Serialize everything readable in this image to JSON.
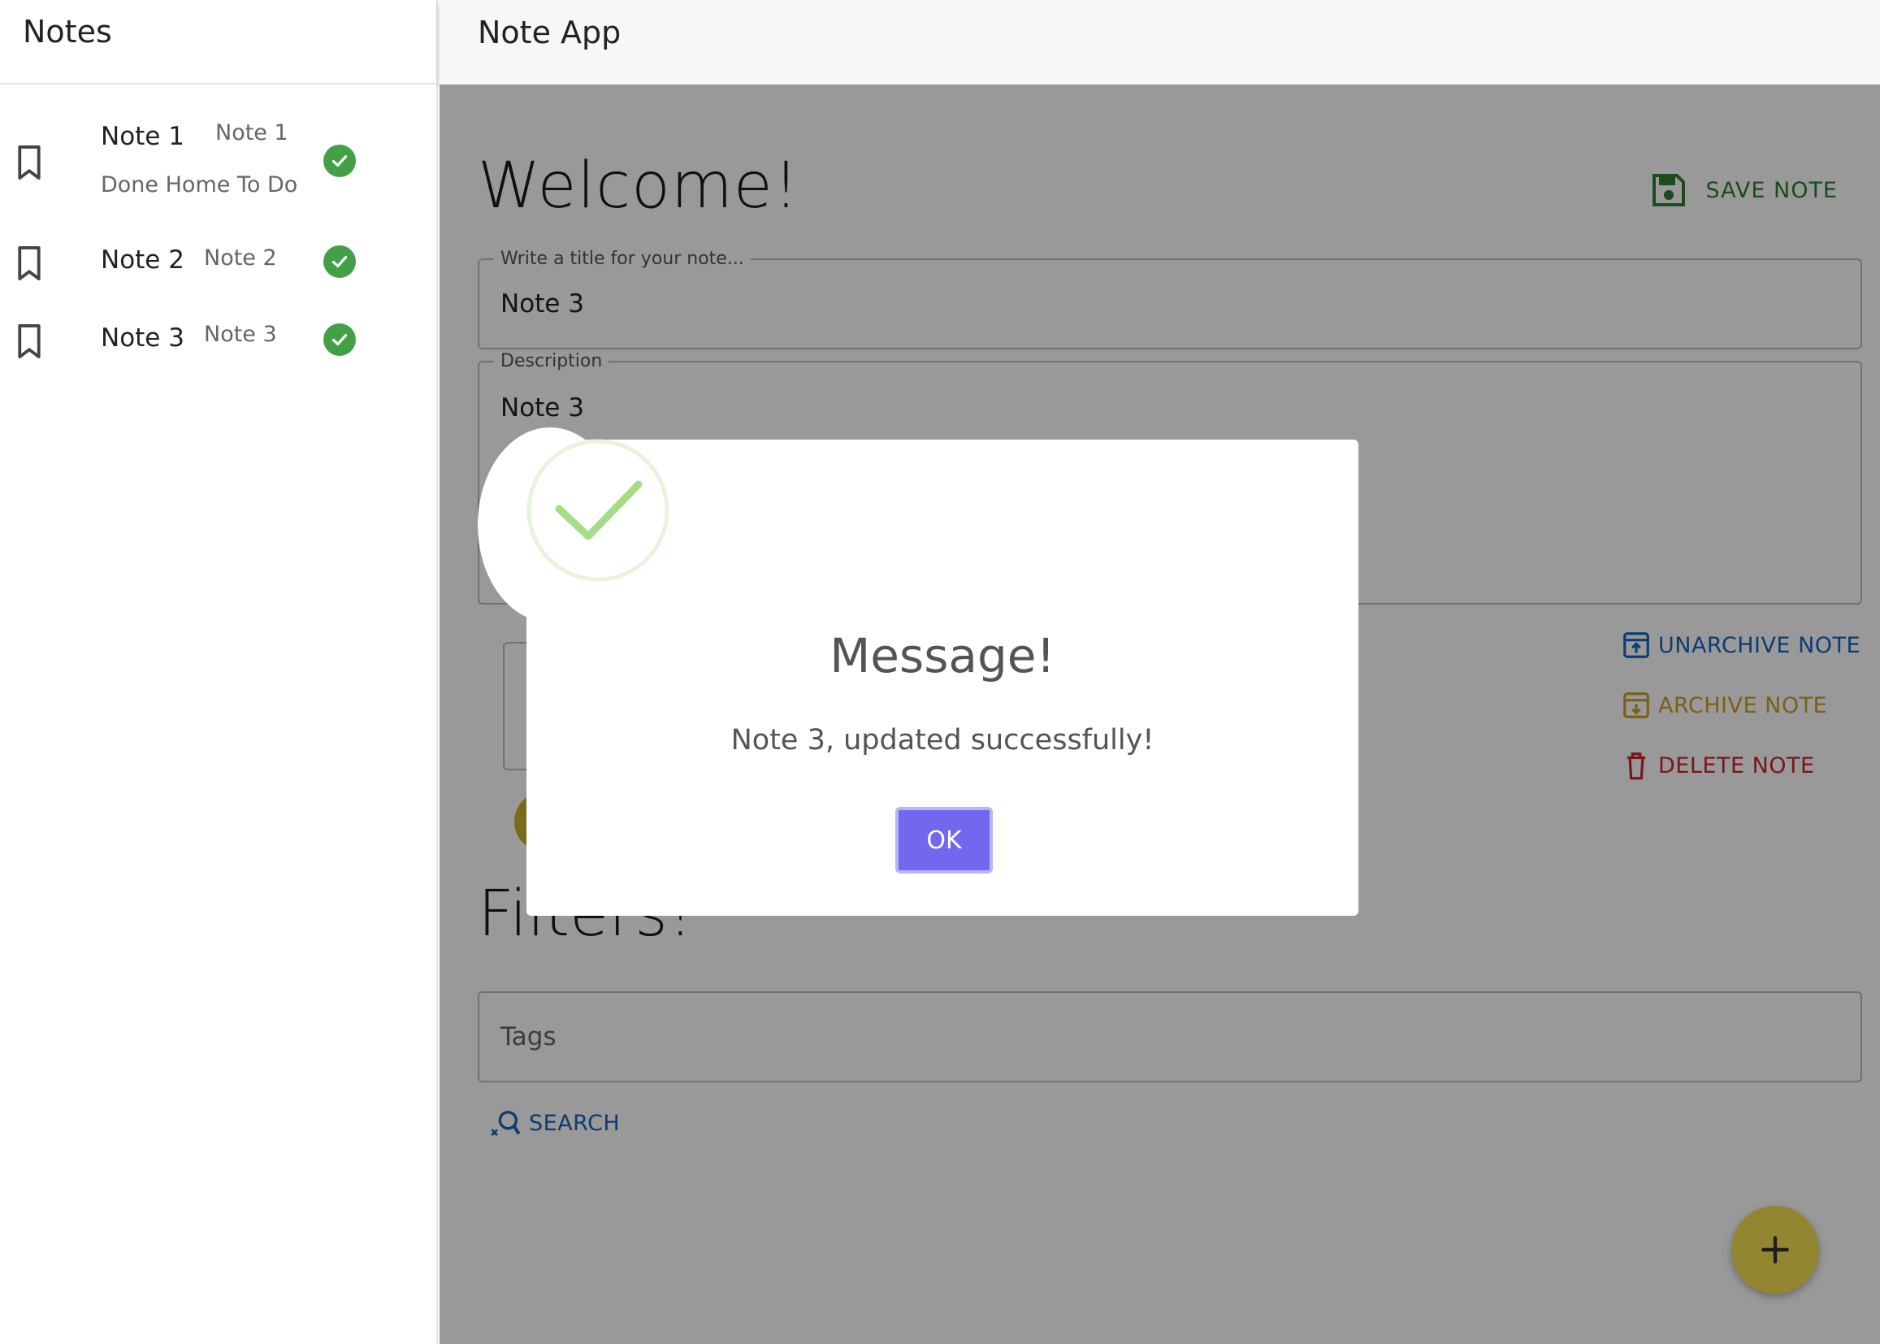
{
  "sidebar": {
    "title": "Notes",
    "notes": [
      {
        "name": "Note 1",
        "description": "Note 1",
        "tags": "Done Home To Do",
        "done": true
      },
      {
        "name": "Note 2",
        "description": "Note 2",
        "tags": "",
        "done": true
      },
      {
        "name": "Note 3",
        "description": "Note 3",
        "tags": "",
        "done": true
      }
    ]
  },
  "appbar": {
    "title": "Note App"
  },
  "editor": {
    "heading": "Welcome!",
    "save_label": "SAVE NOTE",
    "title_label": "Write a title for your note...",
    "title_value": "Note 3",
    "description_label": "Description",
    "description_value": "Note 3",
    "unarchive_label": "UNARCHIVE NOTE",
    "archive_label": "ARCHIVE NOTE",
    "delete_label": "DELETE NOTE"
  },
  "filters": {
    "heading": "Filters!",
    "tags_placeholder": "Tags",
    "search_label": "SEARCH"
  },
  "dialog": {
    "title": "Message!",
    "text": "Note 3, updated successfully!",
    "ok_label": "OK"
  },
  "colors": {
    "save": "#2e7d32",
    "unarchive": "#1565c0",
    "archive": "#c9a227",
    "delete": "#c62828",
    "check": "#43a047",
    "ok_button": "#7367f0",
    "fab": "#f5e050"
  }
}
